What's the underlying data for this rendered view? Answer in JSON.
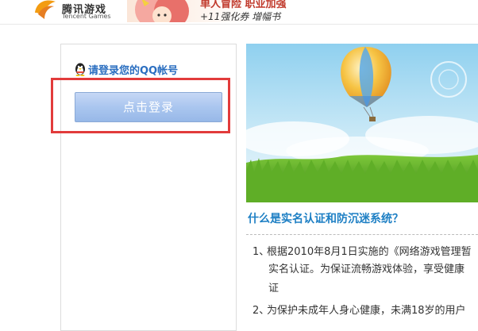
{
  "header": {
    "logo_cn": "腾讯游戏",
    "logo_en": "Tencent Games",
    "banner_line1": "单人冒险 职业加强",
    "banner_line2": "+11强化券 增幅书"
  },
  "login": {
    "title": "请登录您的QQ帐号",
    "button_label": "点击登录"
  },
  "info": {
    "faq_title": "什么是实名认证和防沉迷系统？",
    "items": [
      {
        "num": "1、",
        "line1": "根据2010年8月1日实施的《网络游戏管理暂",
        "line2": "实名认证。为保证流畅游戏体验，享受健康",
        "line3": "证"
      },
      {
        "num": "2、",
        "line1": "为保护未成年人身心健康，未满18岁的用户"
      }
    ]
  },
  "colors": {
    "highlight": "#e23b3b",
    "link_blue": "#2a6ec0",
    "title_blue": "#1d7fc4",
    "button_blue": "#aac6ef"
  },
  "icons": {
    "logo": "tencent-games-logo",
    "qq": "qq-penguin-icon",
    "hero": "hot-air-balloon-illustration"
  }
}
